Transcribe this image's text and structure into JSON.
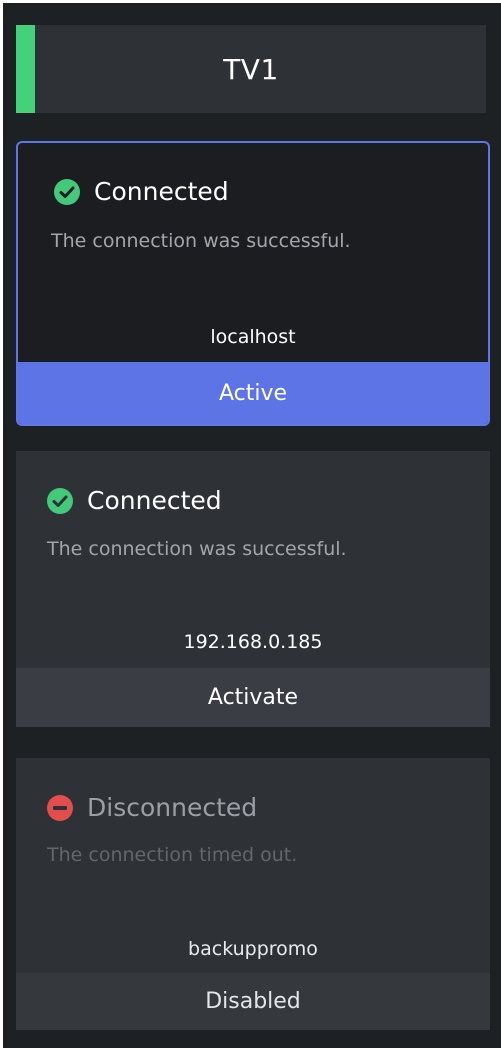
{
  "header": {
    "title": "TV1",
    "accent_color": "#43d17a"
  },
  "connections": [
    {
      "status": "Connected",
      "status_icon": "check-circle-icon",
      "message": "The connection was successful.",
      "host": "localhost",
      "action": "Active",
      "action_color": "#5d74e6"
    },
    {
      "status": "Connected",
      "status_icon": "check-circle-icon",
      "message": "The connection was successful.",
      "host": "192.168.0.185",
      "action": "Activate"
    },
    {
      "status": "Disconnected",
      "status_icon": "minus-circle-icon",
      "message": "The connection timed out.",
      "host": "backuppromo",
      "action": "Disabled"
    }
  ],
  "colors": {
    "connected": "#43c97a",
    "disconnected": "#e04e4e",
    "active_border": "#5e76e6"
  }
}
